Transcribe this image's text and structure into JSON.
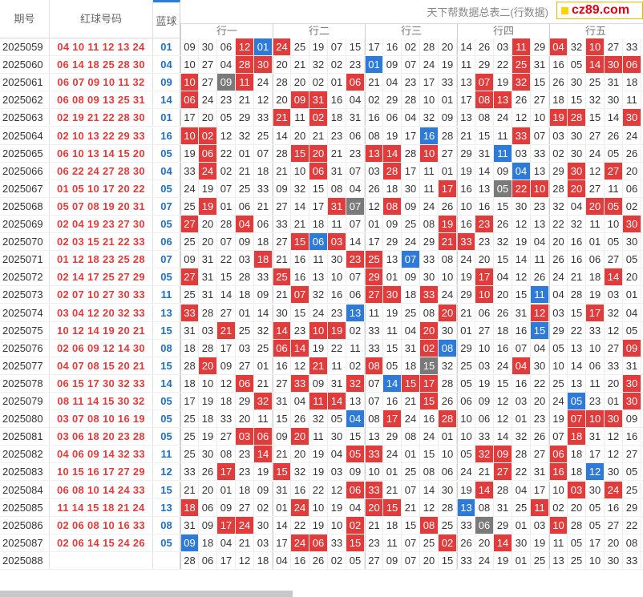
{
  "header": {
    "col_issue": "期号",
    "col_red": "红球号码",
    "col_blue": "蓝球",
    "title": "天下帮数据总表二(行数据)",
    "groups": [
      "行一",
      "行二",
      "行三",
      "行四",
      "行五"
    ],
    "logo": "cz89.com"
  },
  "colors": {
    "red": "#e23b3b",
    "blue": "#2d7ad9",
    "gray": "#7a7a7a"
  },
  "rows": [
    {
      "issue": "2025059",
      "red": "04 10 11 12 13 24",
      "blue": "01",
      "cells": [
        "09",
        "30",
        "06",
        "12",
        "01",
        "24",
        "25",
        "19",
        "07",
        "15",
        "17",
        "16",
        "02",
        "28",
        "20",
        "14",
        "26",
        "03",
        "11",
        "29",
        "04",
        "32",
        "10",
        "27",
        "33"
      ],
      "hl": {
        "3": "r",
        "4": "b",
        "5": "r",
        "18": "r",
        "20": "r",
        "22": "r"
      }
    },
    {
      "issue": "2025060",
      "red": "06 14 18 25 28 30",
      "blue": "04",
      "cells": [
        "10",
        "27",
        "04",
        "28",
        "30",
        "20",
        "21",
        "32",
        "02",
        "23",
        "01",
        "09",
        "07",
        "24",
        "19",
        "11",
        "29",
        "22",
        "25",
        "31",
        "16",
        "05",
        "14",
        "30",
        "06"
      ],
      "hl": {
        "3": "r",
        "4": "r",
        "10": "b",
        "18": "r",
        "22": "r",
        "23": "r",
        "24": "r"
      }
    },
    {
      "issue": "2025061",
      "red": "06 07 09 10 11 32",
      "blue": "09",
      "cells": [
        "10",
        "27",
        "09",
        "11",
        "24",
        "28",
        "20",
        "02",
        "01",
        "06",
        "21",
        "04",
        "23",
        "17",
        "33",
        "13",
        "07",
        "19",
        "32",
        "15",
        "26",
        "30",
        "25",
        "31",
        "18"
      ],
      "hl": {
        "0": "r",
        "2": "g",
        "3": "r",
        "9": "r",
        "16": "r",
        "18": "r"
      }
    },
    {
      "issue": "2025062",
      "red": "06 08 09 13 25 31",
      "blue": "14",
      "cells": [
        "06",
        "24",
        "23",
        "21",
        "12",
        "20",
        "09",
        "31",
        "16",
        "04",
        "02",
        "29",
        "28",
        "10",
        "01",
        "17",
        "08",
        "13",
        "26",
        "27",
        "18",
        "15",
        "32",
        "30",
        "11"
      ],
      "hl": {
        "0": "r",
        "6": "r",
        "7": "r",
        "16": "r",
        "17": "r"
      }
    },
    {
      "issue": "2025063",
      "red": "02 19 21 22 28 30",
      "blue": "01",
      "cells": [
        "17",
        "20",
        "05",
        "29",
        "33",
        "21",
        "11",
        "02",
        "18",
        "31",
        "16",
        "06",
        "04",
        "32",
        "09",
        "13",
        "08",
        "24",
        "12",
        "10",
        "19",
        "28",
        "15",
        "14",
        "30"
      ],
      "hl": {
        "5": "r",
        "7": "r",
        "20": "r",
        "21": "r",
        "24": "r"
      }
    },
    {
      "issue": "2025064",
      "red": "02 10 13 22 29 33",
      "blue": "16",
      "cells": [
        "10",
        "02",
        "12",
        "32",
        "25",
        "14",
        "20",
        "21",
        "23",
        "06",
        "08",
        "19",
        "17",
        "16",
        "28",
        "21",
        "15",
        "11",
        "33",
        "07",
        "03",
        "30",
        "27",
        "26",
        "24"
      ],
      "hl": {
        "0": "r",
        "1": "r",
        "13": "b",
        "18": "r"
      }
    },
    {
      "issue": "2025065",
      "red": "06 10 13 14 15 20",
      "blue": "05",
      "cells": [
        "19",
        "06",
        "22",
        "01",
        "07",
        "28",
        "15",
        "20",
        "21",
        "23",
        "13",
        "14",
        "28",
        "10",
        "27",
        "29",
        "31",
        "11",
        "03",
        "33",
        "02",
        "30",
        "24",
        "05",
        "26"
      ],
      "hl": {
        "1": "r",
        "6": "r",
        "7": "r",
        "10": "r",
        "11": "r",
        "13": "r",
        "17": "b"
      }
    },
    {
      "issue": "2025066",
      "red": "06 22 24 27 28 30",
      "blue": "04",
      "cells": [
        "33",
        "24",
        "02",
        "21",
        "18",
        "21",
        "10",
        "06",
        "31",
        "07",
        "03",
        "28",
        "17",
        "11",
        "01",
        "19",
        "14",
        "09",
        "04",
        "13",
        "29",
        "30",
        "12",
        "27",
        "20"
      ],
      "hl": {
        "1": "r",
        "7": "r",
        "11": "r",
        "18": "b",
        "21": "r",
        "23": "r"
      }
    },
    {
      "issue": "2025067",
      "red": "01 05 10 17 20 22",
      "blue": "05",
      "cells": [
        "24",
        "19",
        "07",
        "25",
        "33",
        "09",
        "32",
        "15",
        "08",
        "04",
        "26",
        "18",
        "30",
        "11",
        "17",
        "16",
        "13",
        "05",
        "22",
        "10",
        "28",
        "20",
        "27",
        "11",
        "06"
      ],
      "hl": {
        "14": "r",
        "17": "g",
        "18": "r",
        "19": "r",
        "21": "r"
      }
    },
    {
      "issue": "2025068",
      "red": "05 07 08 19 20 31",
      "blue": "07",
      "cells": [
        "25",
        "19",
        "01",
        "06",
        "21",
        "27",
        "14",
        "17",
        "31",
        "07",
        "12",
        "08",
        "09",
        "24",
        "26",
        "10",
        "16",
        "15",
        "30",
        "23",
        "32",
        "04",
        "20",
        "05",
        "02"
      ],
      "hl": {
        "1": "r",
        "8": "r",
        "9": "g",
        "11": "r",
        "22": "r",
        "23": "r"
      }
    },
    {
      "issue": "2025069",
      "red": "02 04 19 23 27 30",
      "blue": "05",
      "cells": [
        "27",
        "20",
        "28",
        "04",
        "06",
        "33",
        "21",
        "18",
        "11",
        "07",
        "01",
        "09",
        "25",
        "08",
        "19",
        "16",
        "23",
        "26",
        "12",
        "13",
        "22",
        "32",
        "11",
        "10",
        "30"
      ],
      "hl": {
        "0": "r",
        "3": "r",
        "14": "r",
        "16": "r",
        "24": "r"
      }
    },
    {
      "issue": "2025070",
      "red": "02 03 15 21 22 33",
      "blue": "06",
      "cells": [
        "25",
        "20",
        "07",
        "09",
        "18",
        "27",
        "15",
        "06",
        "03",
        "14",
        "17",
        "29",
        "24",
        "29",
        "21",
        "33",
        "23",
        "32",
        "19",
        "04",
        "20",
        "16",
        "01",
        "05",
        "30"
      ],
      "hl": {
        "6": "r",
        "7": "b",
        "8": "r",
        "14": "r",
        "15": "r"
      }
    },
    {
      "issue": "2025071",
      "red": "01 12 18 23 25 28",
      "blue": "07",
      "cells": [
        "09",
        "31",
        "22",
        "03",
        "18",
        "21",
        "16",
        "11",
        "30",
        "23",
        "25",
        "13",
        "07",
        "33",
        "08",
        "24",
        "20",
        "15",
        "14",
        "11",
        "26",
        "16",
        "06",
        "27",
        "05"
      ],
      "hl": {
        "4": "r",
        "9": "r",
        "10": "r",
        "12": "b"
      }
    },
    {
      "issue": "2025072",
      "red": "02 14 17 25 27 29",
      "blue": "05",
      "cells": [
        "27",
        "31",
        "15",
        "28",
        "33",
        "25",
        "16",
        "13",
        "10",
        "07",
        "29",
        "01",
        "09",
        "30",
        "10",
        "19",
        "17",
        "04",
        "12",
        "26",
        "24",
        "21",
        "18",
        "14",
        "20"
      ],
      "hl": {
        "0": "r",
        "5": "r",
        "10": "r",
        "16": "r",
        "23": "r"
      }
    },
    {
      "issue": "2025073",
      "red": "02 07 10 27 30 33",
      "blue": "11",
      "cells": [
        "25",
        "31",
        "14",
        "18",
        "09",
        "21",
        "07",
        "32",
        "16",
        "06",
        "27",
        "30",
        "18",
        "33",
        "24",
        "29",
        "10",
        "20",
        "15",
        "11",
        "04",
        "28",
        "19",
        "03",
        "01"
      ],
      "hl": {
        "6": "r",
        "10": "r",
        "11": "r",
        "13": "r",
        "16": "r",
        "19": "b"
      }
    },
    {
      "issue": "2025074",
      "red": "03 04 12 20 32 33",
      "blue": "13",
      "cells": [
        "33",
        "28",
        "27",
        "01",
        "14",
        "30",
        "15",
        "24",
        "23",
        "13",
        "11",
        "19",
        "25",
        "08",
        "20",
        "21",
        "06",
        "26",
        "31",
        "12",
        "03",
        "15",
        "17",
        "32",
        "04"
      ],
      "hl": {
        "0": "r",
        "9": "b",
        "14": "r",
        "19": "r",
        "22": "r"
      }
    },
    {
      "issue": "2025075",
      "red": "10 12 14 19 20 21",
      "blue": "15",
      "cells": [
        "31",
        "03",
        "21",
        "25",
        "32",
        "14",
        "23",
        "10",
        "19",
        "02",
        "33",
        "11",
        "04",
        "20",
        "30",
        "01",
        "27",
        "18",
        "16",
        "15",
        "29",
        "22",
        "33",
        "12",
        "05"
      ],
      "hl": {
        "2": "r",
        "5": "r",
        "7": "r",
        "8": "r",
        "13": "r",
        "19": "b"
      }
    },
    {
      "issue": "2025076",
      "red": "02 06 09 12 14 30",
      "blue": "08",
      "cells": [
        "18",
        "28",
        "17",
        "03",
        "25",
        "06",
        "14",
        "19",
        "22",
        "11",
        "33",
        "15",
        "31",
        "02",
        "08",
        "29",
        "10",
        "16",
        "07",
        "04",
        "05",
        "13",
        "10",
        "27",
        "09"
      ],
      "hl": {
        "5": "r",
        "6": "r",
        "13": "r",
        "14": "b",
        "24": "r"
      }
    },
    {
      "issue": "2025077",
      "red": "04 07 08 15 20 21",
      "blue": "15",
      "cells": [
        "28",
        "20",
        "09",
        "27",
        "01",
        "16",
        "12",
        "21",
        "11",
        "02",
        "08",
        "05",
        "18",
        "15",
        "32",
        "25",
        "03",
        "24",
        "04",
        "30",
        "10",
        "14",
        "06",
        "33",
        "31"
      ],
      "hl": {
        "1": "r",
        "7": "r",
        "10": "r",
        "13": "g",
        "18": "r"
      }
    },
    {
      "issue": "2025078",
      "red": "06 15 17 30 32 33",
      "blue": "14",
      "cells": [
        "18",
        "10",
        "12",
        "06",
        "21",
        "27",
        "33",
        "09",
        "31",
        "32",
        "07",
        "14",
        "15",
        "17",
        "28",
        "05",
        "19",
        "15",
        "16",
        "22",
        "25",
        "13",
        "11",
        "20",
        "30"
      ],
      "hl": {
        "3": "r",
        "6": "r",
        "9": "r",
        "11": "b",
        "12": "r",
        "13": "r",
        "24": "r"
      }
    },
    {
      "issue": "2025079",
      "red": "08 11 14 15 30 32",
      "blue": "05",
      "cells": [
        "17",
        "19",
        "18",
        "29",
        "32",
        "31",
        "04",
        "11",
        "14",
        "13",
        "07",
        "16",
        "21",
        "15",
        "26",
        "06",
        "09",
        "12",
        "03",
        "20",
        "24",
        "05",
        "23",
        "01",
        "30"
      ],
      "hl": {
        "4": "r",
        "7": "r",
        "8": "r",
        "13": "r",
        "21": "b",
        "24": "r"
      }
    },
    {
      "issue": "2025080",
      "red": "03 07 08 10 16 19",
      "blue": "05",
      "cells": [
        "25",
        "18",
        "33",
        "20",
        "11",
        "15",
        "26",
        "32",
        "05",
        "04",
        "08",
        "17",
        "24",
        "16",
        "28",
        "10",
        "06",
        "12",
        "01",
        "23",
        "19",
        "07",
        "10",
        "30",
        "09"
      ],
      "hl": {
        "9": "b",
        "11": "r",
        "14": "r",
        "21": "r",
        "22": "r",
        "23": "r"
      }
    },
    {
      "issue": "2025081",
      "red": "03 06 18 20 23 28",
      "blue": "05",
      "cells": [
        "25",
        "19",
        "27",
        "03",
        "06",
        "09",
        "20",
        "11",
        "30",
        "15",
        "13",
        "29",
        "08",
        "24",
        "01",
        "10",
        "33",
        "14",
        "32",
        "26",
        "07",
        "18",
        "31",
        "12",
        "16"
      ],
      "hl": {
        "3": "r",
        "4": "r",
        "6": "r",
        "21": "r"
      }
    },
    {
      "issue": "2025082",
      "red": "04 06 09 14 32 33",
      "blue": "11",
      "cells": [
        "25",
        "30",
        "08",
        "23",
        "14",
        "21",
        "20",
        "19",
        "04",
        "05",
        "33",
        "24",
        "01",
        "15",
        "10",
        "05",
        "32",
        "09",
        "28",
        "27",
        "06",
        "18",
        "17",
        "12",
        "27"
      ],
      "hl": {
        "4": "r",
        "9": "r",
        "10": "r",
        "16": "r",
        "17": "r",
        "20": "r"
      }
    },
    {
      "issue": "2025083",
      "red": "10 15 16 17 27 29",
      "blue": "12",
      "cells": [
        "33",
        "26",
        "17",
        "23",
        "19",
        "15",
        "32",
        "19",
        "03",
        "09",
        "10",
        "01",
        "25",
        "08",
        "06",
        "24",
        "21",
        "27",
        "22",
        "31",
        "16",
        "18",
        "12",
        "30",
        "05"
      ],
      "hl": {
        "2": "r",
        "5": "r",
        "17": "r",
        "20": "r",
        "22": "b"
      }
    },
    {
      "issue": "2025084",
      "red": "06 08 10 14 24 33",
      "blue": "15",
      "cells": [
        "21",
        "20",
        "01",
        "18",
        "09",
        "31",
        "16",
        "22",
        "12",
        "06",
        "33",
        "21",
        "07",
        "14",
        "30",
        "19",
        "14",
        "28",
        "04",
        "17",
        "10",
        "03",
        "30",
        "24",
        "25"
      ],
      "hl": {
        "9": "r",
        "10": "r",
        "16": "r",
        "21": "r",
        "23": "r"
      }
    },
    {
      "issue": "2025085",
      "red": "11 14 15 18 21 24",
      "blue": "13",
      "cells": [
        "18",
        "06",
        "09",
        "27",
        "02",
        "01",
        "24",
        "10",
        "19",
        "04",
        "20",
        "15",
        "21",
        "12",
        "28",
        "13",
        "08",
        "31",
        "25",
        "11",
        "02",
        "20",
        "05",
        "16",
        "29"
      ],
      "hl": {
        "0": "r",
        "6": "r",
        "10": "r",
        "11": "r",
        "15": "b",
        "19": "r"
      }
    },
    {
      "issue": "2025086",
      "red": "02 06 08 10 16 33",
      "blue": "08",
      "cells": [
        "31",
        "09",
        "17",
        "24",
        "30",
        "14",
        "22",
        "19",
        "10",
        "02",
        "21",
        "18",
        "15",
        "08",
        "25",
        "33",
        "06",
        "29",
        "01",
        "03",
        "10",
        "28",
        "05",
        "27",
        "22"
      ],
      "hl": {
        "2": "r",
        "3": "r",
        "9": "r",
        "13": "r",
        "16": "g",
        "20": "r"
      }
    },
    {
      "issue": "2025087",
      "red": "02 06 14 15 24 26",
      "blue": "05",
      "cells": [
        "09",
        "18",
        "04",
        "21",
        "03",
        "17",
        "24",
        "06",
        "33",
        "15",
        "23",
        "11",
        "07",
        "25",
        "02",
        "26",
        "20",
        "14",
        "30",
        "19",
        "11",
        "05",
        "17",
        "20",
        "08"
      ],
      "hl": {
        "0": "b",
        "6": "r",
        "7": "r",
        "9": "r",
        "14": "r",
        "17": "r"
      }
    },
    {
      "issue": "2025088",
      "red": "",
      "blue": "",
      "cells": [
        "28",
        "06",
        "17",
        "12",
        "18",
        "04",
        "16",
        "26",
        "02",
        "05",
        "27",
        "09",
        "07",
        "20",
        "15",
        "33",
        "24",
        "19",
        "01",
        "25",
        "13",
        "25",
        "10",
        "30",
        "33"
      ],
      "hl": {}
    }
  ]
}
